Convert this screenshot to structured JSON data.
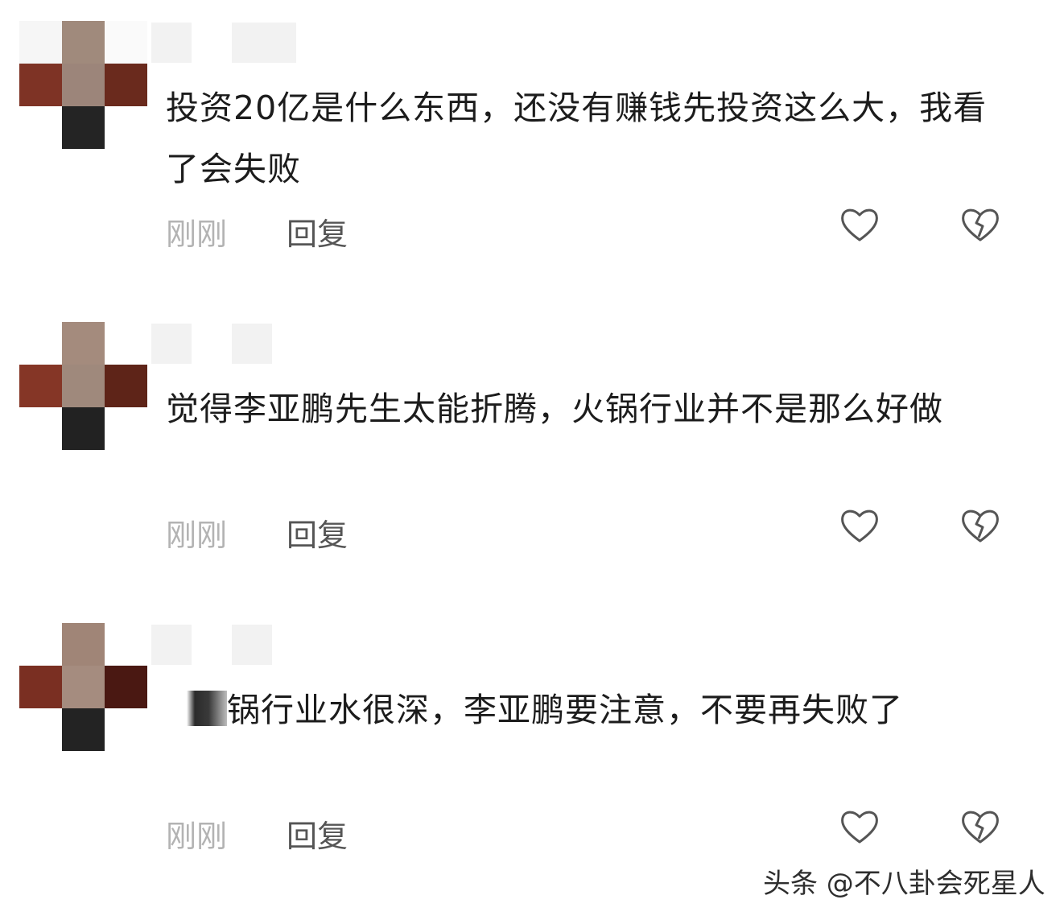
{
  "comments": [
    {
      "text": "投资20亿是什么东西，还没有赚钱先投资这么大，我看了会失败",
      "timestamp": "刚刚",
      "reply_label": "回复",
      "like_icon": "heart-outline",
      "dislike_icon": "broken-heart-outline"
    },
    {
      "text": "觉得李亚鹏先生太能折腾，火锅行业并不是那么好做",
      "timestamp": "刚刚",
      "reply_label": "回复",
      "like_icon": "heart-outline",
      "dislike_icon": "broken-heart-outline"
    },
    {
      "text": "锅行业水很深，李亚鹏要注意，不要再失败了",
      "timestamp": "刚刚",
      "reply_label": "回复",
      "like_icon": "heart-outline",
      "dislike_icon": "broken-heart-outline"
    }
  ],
  "watermark": "头条 @不八卦会死星人",
  "colors": {
    "text": "#1c1c1c",
    "meta_gray": "#b3b3b3",
    "reply_gray": "#555555",
    "icon_gray": "#555555",
    "avatar_palette": [
      "#8b3a2a",
      "#a08878",
      "#5a1f18",
      "#222222",
      "#9a7f6e",
      "#f5f5f5"
    ]
  }
}
